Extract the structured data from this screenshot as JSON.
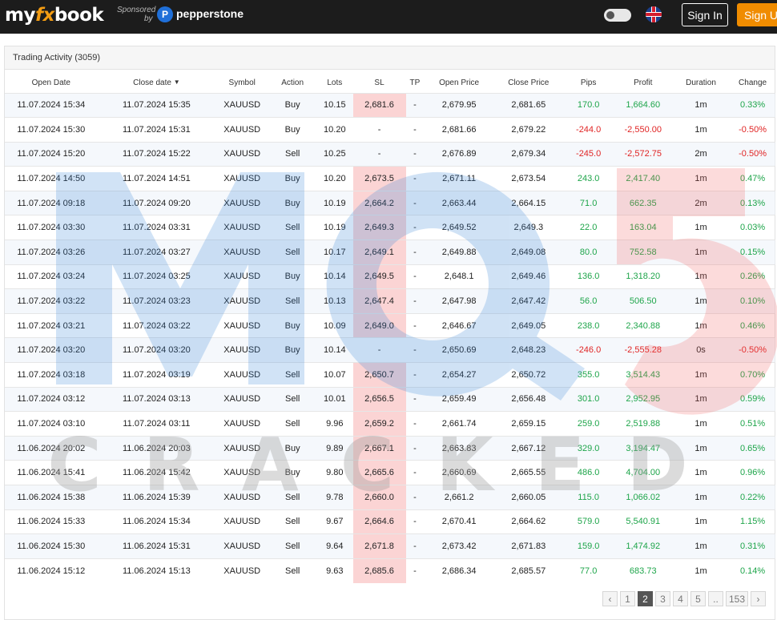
{
  "header": {
    "logo_prefix": "my",
    "logo_fx": "fx",
    "logo_suffix": "book",
    "sponsored_label": "Sponsored",
    "sponsored_by": "by",
    "sponsor_name": "pepperstone",
    "signin_label": "Sign In",
    "signup_label": "Sign Up",
    "accent_color": "#f08c00"
  },
  "panel": {
    "title": "Trading Activity (3059)"
  },
  "watermark": {
    "logo_text": "MQL5",
    "text": "CRACKED"
  },
  "table": {
    "columns": [
      "Open Date",
      "Close date",
      "Symbol",
      "Action",
      "Lots",
      "SL",
      "TP",
      "Open Price",
      "Close Price",
      "Pips",
      "Profit",
      "Duration",
      "Change"
    ],
    "sort_indicator": "▼",
    "rows": [
      {
        "open": "11.07.2024 15:34",
        "close": "11.07.2024 15:35",
        "symbol": "XAUUSD",
        "action": "Buy",
        "lots": "10.15",
        "sl": "2,681.6",
        "sl_hit": true,
        "tp": "-",
        "open_price": "2,679.95",
        "close_price": "2,681.65",
        "pips": "170.0",
        "profit": "1,664.60",
        "duration": "1m",
        "change": "0.33%",
        "positive": true
      },
      {
        "open": "11.07.2024 15:30",
        "close": "11.07.2024 15:31",
        "symbol": "XAUUSD",
        "action": "Buy",
        "lots": "10.20",
        "sl": "-",
        "sl_hit": false,
        "tp": "-",
        "open_price": "2,681.66",
        "close_price": "2,679.22",
        "pips": "-244.0",
        "profit": "-2,550.00",
        "duration": "1m",
        "change": "-0.50%",
        "positive": false
      },
      {
        "open": "11.07.2024 15:20",
        "close": "11.07.2024 15:22",
        "symbol": "XAUUSD",
        "action": "Sell",
        "lots": "10.25",
        "sl": "-",
        "sl_hit": false,
        "tp": "-",
        "open_price": "2,676.89",
        "close_price": "2,679.34",
        "pips": "-245.0",
        "profit": "-2,572.75",
        "duration": "2m",
        "change": "-0.50%",
        "positive": false
      },
      {
        "open": "11.07.2024 14:50",
        "close": "11.07.2024 14:51",
        "symbol": "XAUUSD",
        "action": "Buy",
        "lots": "10.20",
        "sl": "2,673.5",
        "sl_hit": true,
        "tp": "-",
        "open_price": "2,671.11",
        "close_price": "2,673.54",
        "pips": "243.0",
        "profit": "2,417.40",
        "duration": "1m",
        "change": "0.47%",
        "positive": true
      },
      {
        "open": "11.07.2024 09:18",
        "close": "11.07.2024 09:20",
        "symbol": "XAUUSD",
        "action": "Buy",
        "lots": "10.19",
        "sl": "2,664.2",
        "sl_hit": true,
        "tp": "-",
        "open_price": "2,663.44",
        "close_price": "2,664.15",
        "pips": "71.0",
        "profit": "662.35",
        "duration": "2m",
        "change": "0.13%",
        "positive": true
      },
      {
        "open": "11.07.2024 03:30",
        "close": "11.07.2024 03:31",
        "symbol": "XAUUSD",
        "action": "Sell",
        "lots": "10.19",
        "sl": "2,649.3",
        "sl_hit": true,
        "tp": "-",
        "open_price": "2,649.52",
        "close_price": "2,649.3",
        "pips": "22.0",
        "profit": "163.04",
        "duration": "1m",
        "change": "0.03%",
        "positive": true
      },
      {
        "open": "11.07.2024 03:26",
        "close": "11.07.2024 03:27",
        "symbol": "XAUUSD",
        "action": "Sell",
        "lots": "10.17",
        "sl": "2,649.1",
        "sl_hit": true,
        "tp": "-",
        "open_price": "2,649.88",
        "close_price": "2,649.08",
        "pips": "80.0",
        "profit": "752.58",
        "duration": "1m",
        "change": "0.15%",
        "positive": true
      },
      {
        "open": "11.07.2024 03:24",
        "close": "11.07.2024 03:25",
        "symbol": "XAUUSD",
        "action": "Buy",
        "lots": "10.14",
        "sl": "2,649.5",
        "sl_hit": true,
        "tp": "-",
        "open_price": "2,648.1",
        "close_price": "2,649.46",
        "pips": "136.0",
        "profit": "1,318.20",
        "duration": "1m",
        "change": "0.26%",
        "positive": true
      },
      {
        "open": "11.07.2024 03:22",
        "close": "11.07.2024 03:23",
        "symbol": "XAUUSD",
        "action": "Sell",
        "lots": "10.13",
        "sl": "2,647.4",
        "sl_hit": true,
        "tp": "-",
        "open_price": "2,647.98",
        "close_price": "2,647.42",
        "pips": "56.0",
        "profit": "506.50",
        "duration": "1m",
        "change": "0.10%",
        "positive": true
      },
      {
        "open": "11.07.2024 03:21",
        "close": "11.07.2024 03:22",
        "symbol": "XAUUSD",
        "action": "Buy",
        "lots": "10.09",
        "sl": "2,649.0",
        "sl_hit": true,
        "tp": "-",
        "open_price": "2,646.67",
        "close_price": "2,649.05",
        "pips": "238.0",
        "profit": "2,340.88",
        "duration": "1m",
        "change": "0.46%",
        "positive": true
      },
      {
        "open": "11.07.2024 03:20",
        "close": "11.07.2024 03:20",
        "symbol": "XAUUSD",
        "action": "Buy",
        "lots": "10.14",
        "sl": "-",
        "sl_hit": false,
        "tp": "-",
        "open_price": "2,650.69",
        "close_price": "2,648.23",
        "pips": "-246.0",
        "profit": "-2,555.28",
        "duration": "0s",
        "change": "-0.50%",
        "positive": false
      },
      {
        "open": "11.07.2024 03:18",
        "close": "11.07.2024 03:19",
        "symbol": "XAUUSD",
        "action": "Sell",
        "lots": "10.07",
        "sl": "2,650.7",
        "sl_hit": true,
        "tp": "-",
        "open_price": "2,654.27",
        "close_price": "2,650.72",
        "pips": "355.0",
        "profit": "3,514.43",
        "duration": "1m",
        "change": "0.70%",
        "positive": true
      },
      {
        "open": "11.07.2024 03:12",
        "close": "11.07.2024 03:13",
        "symbol": "XAUUSD",
        "action": "Sell",
        "lots": "10.01",
        "sl": "2,656.5",
        "sl_hit": true,
        "tp": "-",
        "open_price": "2,659.49",
        "close_price": "2,656.48",
        "pips": "301.0",
        "profit": "2,952.95",
        "duration": "1m",
        "change": "0.59%",
        "positive": true
      },
      {
        "open": "11.07.2024 03:10",
        "close": "11.07.2024 03:11",
        "symbol": "XAUUSD",
        "action": "Sell",
        "lots": "9.96",
        "sl": "2,659.2",
        "sl_hit": true,
        "tp": "-",
        "open_price": "2,661.74",
        "close_price": "2,659.15",
        "pips": "259.0",
        "profit": "2,519.88",
        "duration": "1m",
        "change": "0.51%",
        "positive": true
      },
      {
        "open": "11.06.2024 20:02",
        "close": "11.06.2024 20:03",
        "symbol": "XAUUSD",
        "action": "Buy",
        "lots": "9.89",
        "sl": "2,667.1",
        "sl_hit": true,
        "tp": "-",
        "open_price": "2,663.83",
        "close_price": "2,667.12",
        "pips": "329.0",
        "profit": "3,194.47",
        "duration": "1m",
        "change": "0.65%",
        "positive": true
      },
      {
        "open": "11.06.2024 15:41",
        "close": "11.06.2024 15:42",
        "symbol": "XAUUSD",
        "action": "Buy",
        "lots": "9.80",
        "sl": "2,665.6",
        "sl_hit": true,
        "tp": "-",
        "open_price": "2,660.69",
        "close_price": "2,665.55",
        "pips": "486.0",
        "profit": "4,704.00",
        "duration": "1m",
        "change": "0.96%",
        "positive": true
      },
      {
        "open": "11.06.2024 15:38",
        "close": "11.06.2024 15:39",
        "symbol": "XAUUSD",
        "action": "Sell",
        "lots": "9.78",
        "sl": "2,660.0",
        "sl_hit": true,
        "tp": "-",
        "open_price": "2,661.2",
        "close_price": "2,660.05",
        "pips": "115.0",
        "profit": "1,066.02",
        "duration": "1m",
        "change": "0.22%",
        "positive": true
      },
      {
        "open": "11.06.2024 15:33",
        "close": "11.06.2024 15:34",
        "symbol": "XAUUSD",
        "action": "Sell",
        "lots": "9.67",
        "sl": "2,664.6",
        "sl_hit": true,
        "tp": "-",
        "open_price": "2,670.41",
        "close_price": "2,664.62",
        "pips": "579.0",
        "profit": "5,540.91",
        "duration": "1m",
        "change": "1.15%",
        "positive": true
      },
      {
        "open": "11.06.2024 15:30",
        "close": "11.06.2024 15:31",
        "symbol": "XAUUSD",
        "action": "Sell",
        "lots": "9.64",
        "sl": "2,671.8",
        "sl_hit": true,
        "tp": "-",
        "open_price": "2,673.42",
        "close_price": "2,671.83",
        "pips": "159.0",
        "profit": "1,474.92",
        "duration": "1m",
        "change": "0.31%",
        "positive": true
      },
      {
        "open": "11.06.2024 15:12",
        "close": "11.06.2024 15:13",
        "symbol": "XAUUSD",
        "action": "Sell",
        "lots": "9.63",
        "sl": "2,685.6",
        "sl_hit": true,
        "tp": "-",
        "open_price": "2,686.34",
        "close_price": "2,685.57",
        "pips": "77.0",
        "profit": "683.73",
        "duration": "1m",
        "change": "0.14%",
        "positive": true
      }
    ]
  },
  "pagination": {
    "prev_icon": "chevron-left-icon",
    "next_icon": "chevron-right-icon",
    "pages": [
      "1",
      "2",
      "3",
      "4",
      "5",
      "..",
      "153"
    ],
    "active": "2",
    "prev_label": "‹",
    "next_label": "›"
  },
  "colors": {
    "positive": "#1ea54a",
    "negative": "#e02424",
    "sl_hit_bg": "#facdcd"
  }
}
